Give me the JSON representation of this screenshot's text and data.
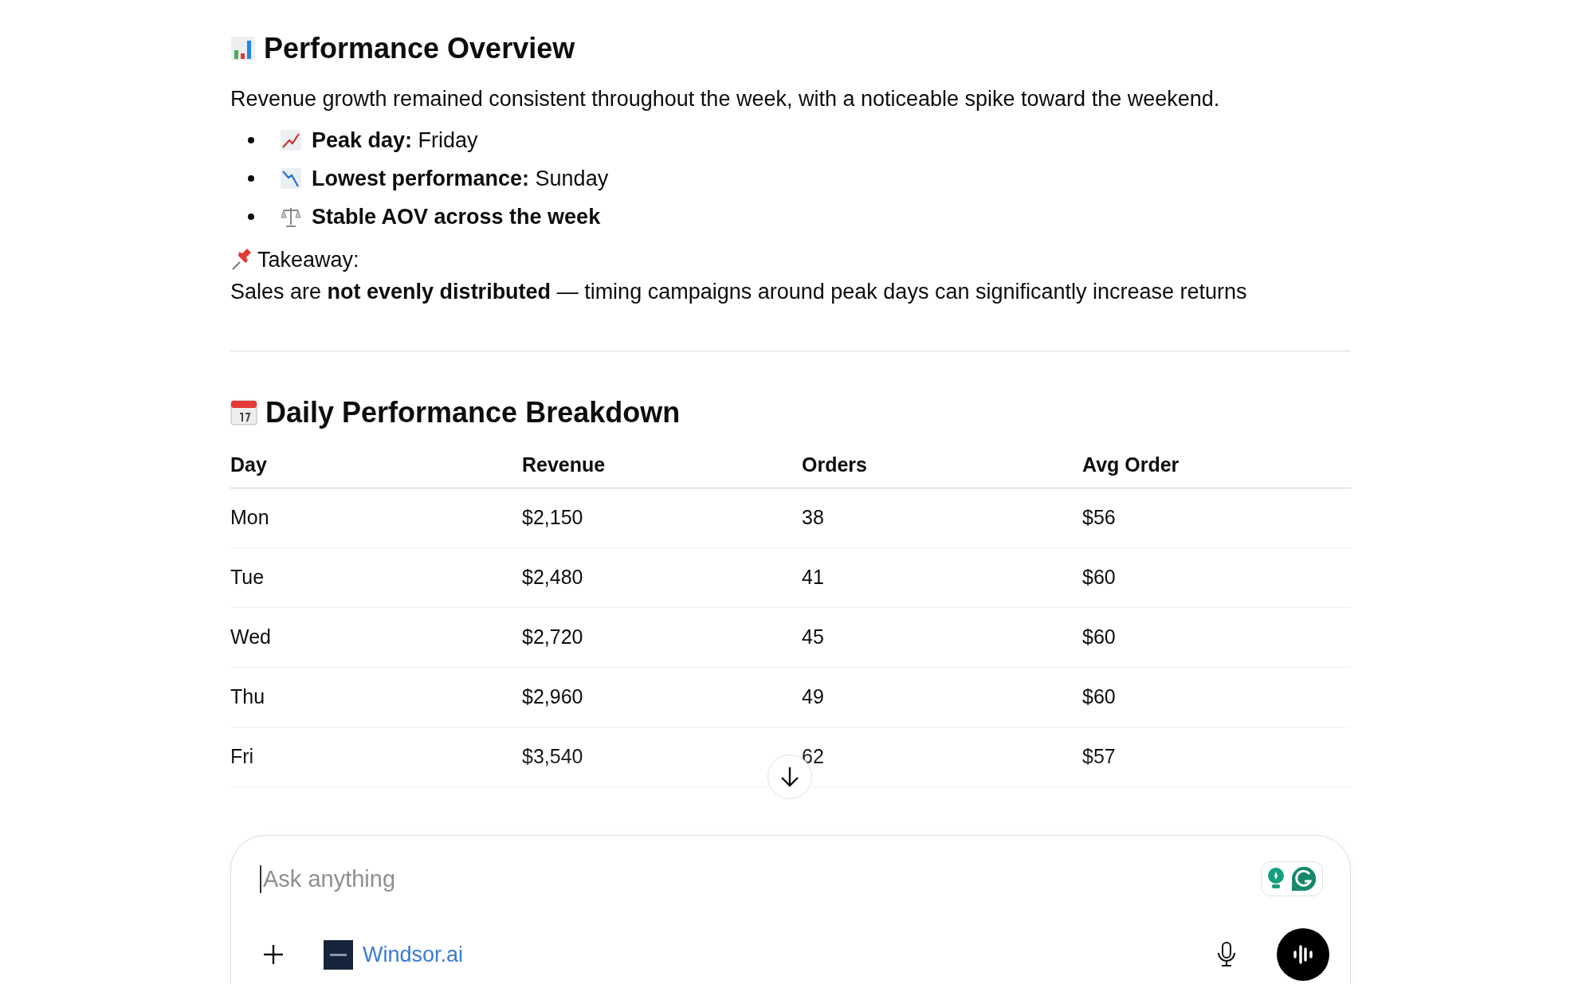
{
  "overview": {
    "title": "Performance Overview",
    "intro": "Revenue growth remained consistent throughout the week, with a noticeable spike toward the weekend.",
    "bullets": [
      {
        "label": "Peak day:",
        "value": "Friday"
      },
      {
        "label": "Lowest performance:",
        "value": "Sunday"
      },
      {
        "label": "Stable AOV across the week"
      }
    ],
    "takeaway_label": "Takeaway:",
    "takeaway": "Sales are **not evenly distributed** — timing campaigns around peak days can significantly increase returns"
  },
  "breakdown": {
    "title": "Daily Performance Breakdown",
    "columns": [
      "Day",
      "Revenue",
      "Orders",
      "Avg Order"
    ],
    "rows": [
      [
        "Mon",
        "$2,150",
        "38",
        "$56"
      ],
      [
        "Tue",
        "$2,480",
        "41",
        "$60"
      ],
      [
        "Wed",
        "$2,720",
        "45",
        "$60"
      ],
      [
        "Thu",
        "$2,960",
        "49",
        "$60"
      ],
      [
        "Fri",
        "$3,540",
        "62",
        "$57"
      ]
    ]
  },
  "composer": {
    "placeholder": "Ask anything",
    "connector": "Windsor.ai"
  }
}
